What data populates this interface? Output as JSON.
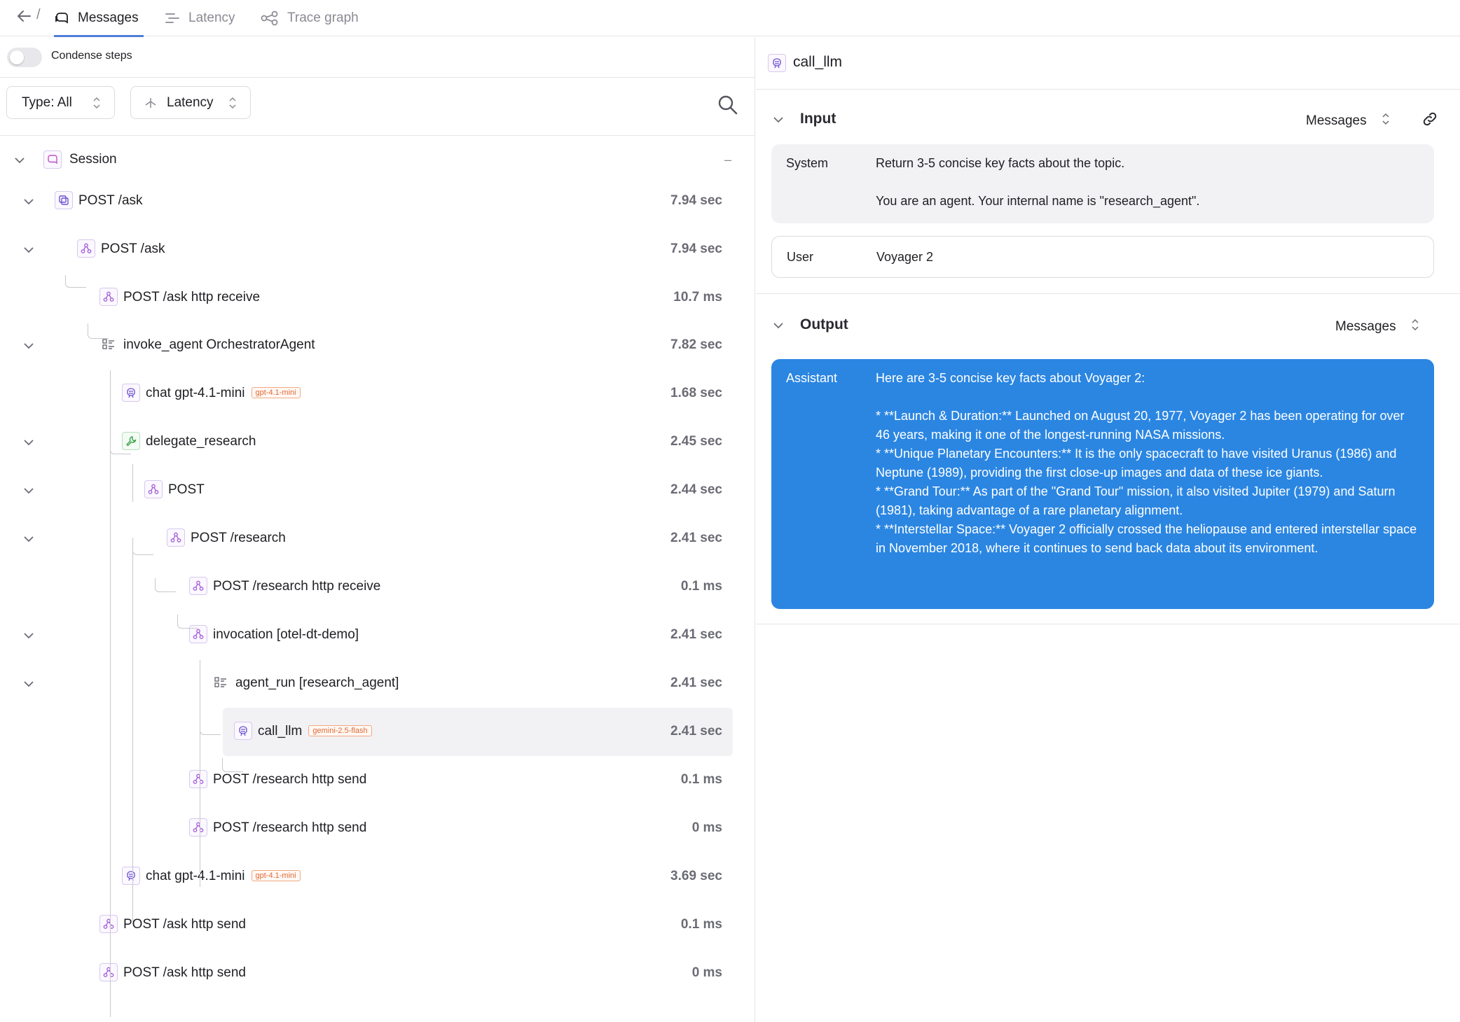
{
  "nav": {
    "tabs": [
      {
        "label": "Messages",
        "icon": "messages-icon",
        "active": true
      },
      {
        "label": "Latency",
        "icon": "latency-icon",
        "active": false
      },
      {
        "label": "Trace graph",
        "icon": "trace-graph-icon",
        "active": false
      }
    ],
    "slash": "/"
  },
  "left": {
    "condense_label": "Condense steps",
    "condense_on": false,
    "type_filter": "Type: All",
    "sort_select": "Latency"
  },
  "tree": {
    "session": "Session",
    "session_dash": "–",
    "rows": [
      {
        "label": "POST /ask",
        "duration": "7.94 sec",
        "icon": "request-icon"
      },
      {
        "label": "POST /ask",
        "duration": "7.94 sec",
        "icon": "span-icon"
      },
      {
        "label": "POST /ask http receive",
        "duration": "10.7 ms",
        "icon": "span-icon"
      },
      {
        "label": "invoke_agent OrchestratorAgent",
        "duration": "7.82 sec",
        "icon": "agent-icon"
      },
      {
        "label": "chat gpt-4.1-mini",
        "duration": "1.68 sec",
        "icon": "llm-icon",
        "badge": "gpt-4.1-mini"
      },
      {
        "label": "delegate_research",
        "duration": "2.45 sec",
        "icon": "tool-icon"
      },
      {
        "label": "POST",
        "duration": "2.44 sec",
        "icon": "span-icon"
      },
      {
        "label": "POST /research",
        "duration": "2.41 sec",
        "icon": "span-icon"
      },
      {
        "label": "POST /research http receive",
        "duration": "0.1 ms",
        "icon": "span-icon"
      },
      {
        "label": "invocation [otel-dt-demo]",
        "duration": "2.41 sec",
        "icon": "span-icon"
      },
      {
        "label": "agent_run [research_agent]",
        "duration": "2.41 sec",
        "icon": "agent-icon"
      },
      {
        "label": "call_llm",
        "duration": "2.41 sec",
        "icon": "llm-icon",
        "badge": "gemini-2.5-flash",
        "selected": true
      },
      {
        "label": "POST /research http send",
        "duration": "0.1 ms",
        "icon": "span-icon"
      },
      {
        "label": "POST /research http send",
        "duration": "0 ms",
        "icon": "span-icon"
      },
      {
        "label": "chat gpt-4.1-mini",
        "duration": "3.69 sec",
        "icon": "llm-icon",
        "badge": "gpt-4.1-mini"
      },
      {
        "label": "POST /ask http send",
        "duration": "0.1 ms",
        "icon": "span-icon"
      },
      {
        "label": "POST /ask http send",
        "duration": "0 ms",
        "icon": "span-icon"
      }
    ]
  },
  "detail": {
    "title": "call_llm",
    "input": {
      "title": "Input",
      "format": "Messages",
      "system_role": "System",
      "system_text": "Return 3-5 concise key facts about the topic.\n\nYou are an agent. Your internal name is \"research_agent\".",
      "user_role": "User",
      "user_text": "Voyager 2"
    },
    "output": {
      "title": "Output",
      "format": "Messages",
      "assistant_role": "Assistant",
      "assistant_text": "Here are 3-5 concise key facts about Voyager 2:\n\n* **Launch & Duration:** Launched on August 20, 1977, Voyager 2 has been operating for over 46 years, making it one of the longest-running NASA missions.\n* **Unique Planetary Encounters:** It is the only spacecraft to have visited Uranus (1986) and Neptune (1989), providing the first close-up images and data of these ice giants.\n* **Grand Tour:** As part of the \"Grand Tour\" mission, it also visited Jupiter (1979) and Saturn (1981), taking advantage of a rare planetary alignment.\n* **Interstellar Space:** Voyager 2 officially crossed the heliopause and entered interstellar space in November 2018, where it continues to send back data about its environment."
    }
  },
  "colors": {
    "accent": "#4f7fd9",
    "assistant_bg": "#2b86e2",
    "badge": "#e06a35",
    "span_icon": "#a45bd8",
    "tool_icon": "#3aa24a"
  }
}
